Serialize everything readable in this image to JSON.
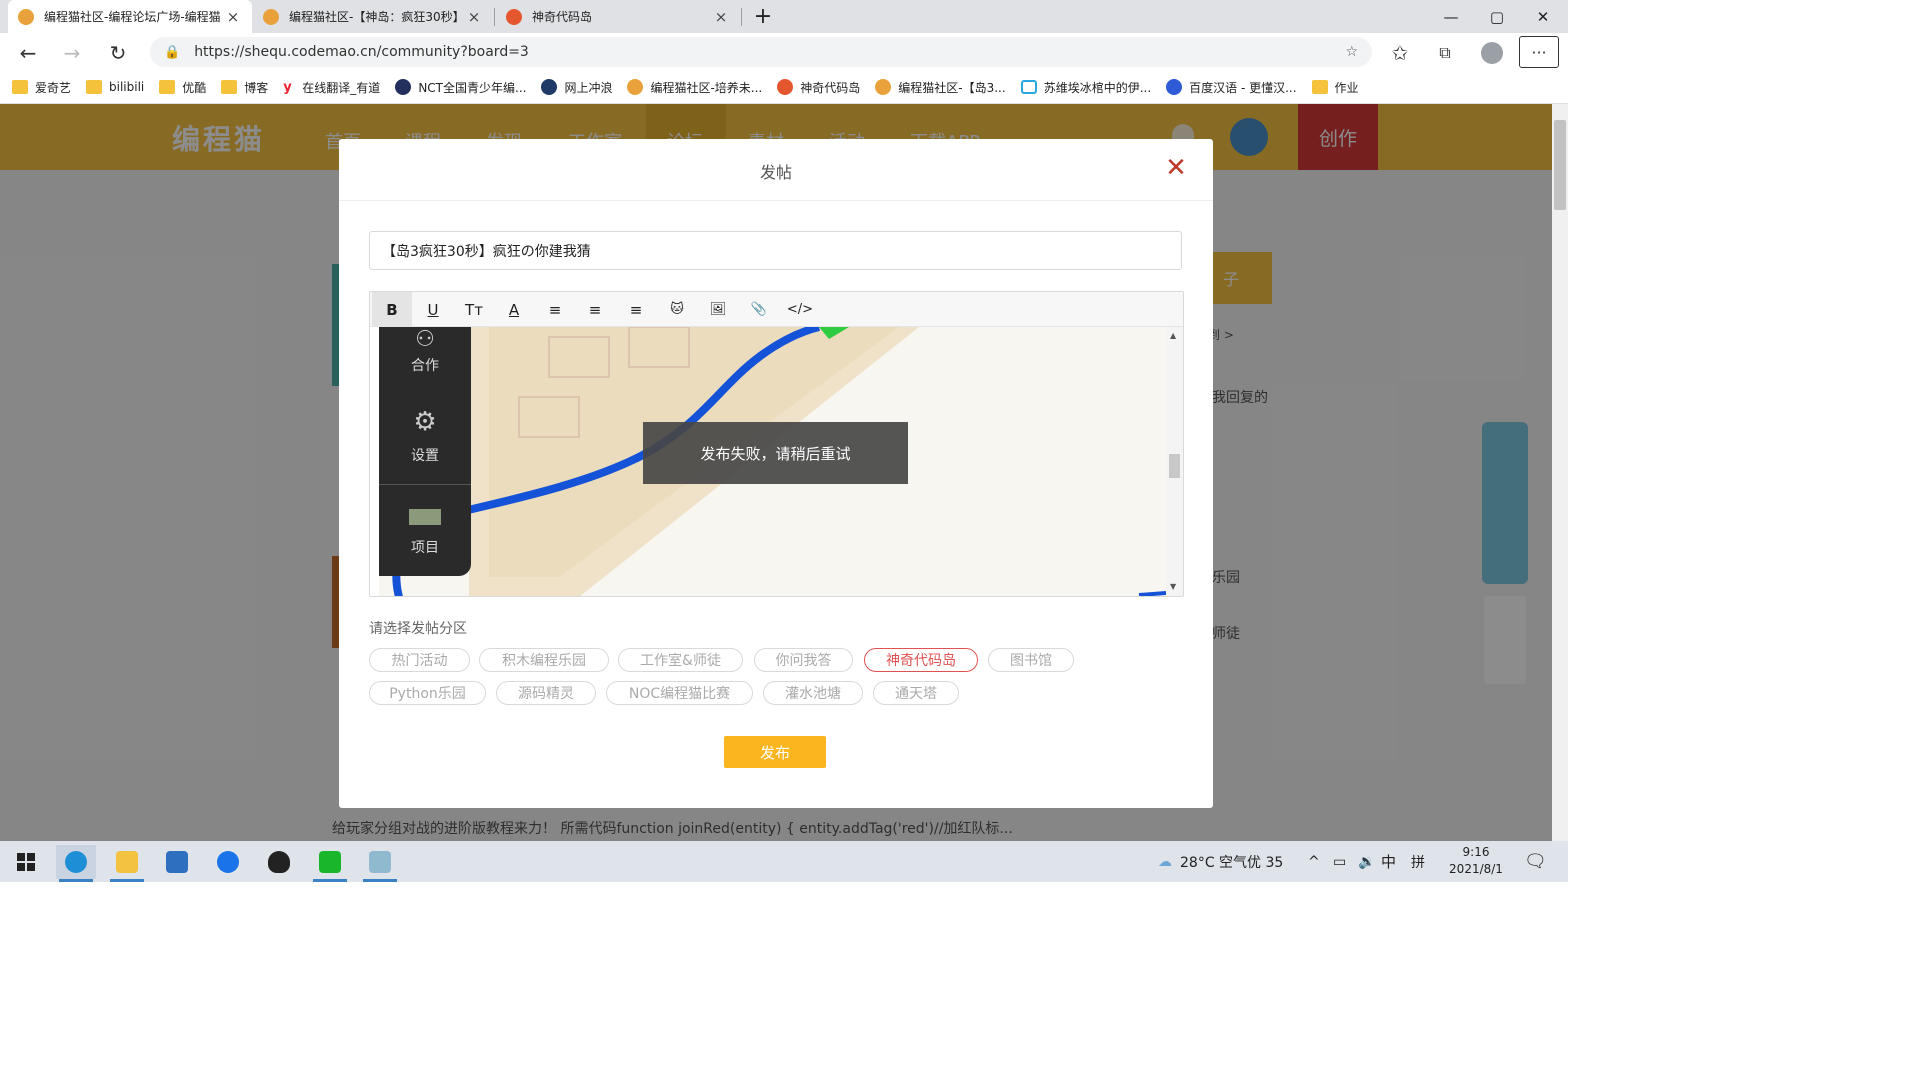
{
  "browser": {
    "tabs": [
      {
        "title": "编程猫社区-编程论坛广场-编程猫",
        "favicon_color": "#e9a23b",
        "active": true
      },
      {
        "title": "编程猫社区-【神岛：疯狂30秒】",
        "favicon_color": "#e9a23b",
        "active": false
      },
      {
        "title": "神奇代码岛",
        "favicon_color": "#e4572e",
        "active": false
      }
    ],
    "new_tab_symbol": "+",
    "close_symbol": "×",
    "window_controls": {
      "minimize": "—",
      "maximize": "▢",
      "close": "✕"
    },
    "url": "https://shequ.codemao.cn/community?board=3",
    "bookmarks": [
      {
        "label": "爱奇艺",
        "icon": "folder-icon"
      },
      {
        "label": "bilibili",
        "icon": "folder-icon"
      },
      {
        "label": "优酷",
        "icon": "folder-icon"
      },
      {
        "label": "博客",
        "icon": "folder-icon"
      },
      {
        "label": "在线翻译_有道",
        "icon": "youdao-icon"
      },
      {
        "label": "NCT全国青少年编...",
        "icon": "nct-icon"
      },
      {
        "label": "网上冲浪",
        "icon": "globe-icon"
      },
      {
        "label": "编程猫社区-培养未...",
        "icon": "codemao-icon"
      },
      {
        "label": "神奇代码岛",
        "icon": "codeisland-icon"
      },
      {
        "label": "编程猫社区-【岛3...",
        "icon": "codemao-icon"
      },
      {
        "label": "苏维埃冰棺中的伊...",
        "icon": "bilibili-icon"
      },
      {
        "label": "百度汉语 - 更懂汉...",
        "icon": "baidu-icon"
      },
      {
        "label": "作业",
        "icon": "folder-icon"
      }
    ]
  },
  "site": {
    "logo": "编程猫",
    "nav": [
      "首页",
      "课程",
      "发现",
      "工作室",
      "论坛",
      "素材",
      "活动",
      "下载APP"
    ],
    "create_label": "创作",
    "accent": "#f6c343"
  },
  "modal": {
    "title": "发帖",
    "close_symbol": "✕",
    "post_title_value": "【岛3疯狂30秒】疯狂の你建我猜",
    "toolbar": [
      "B",
      "U",
      "Tт",
      "A",
      "≡",
      "≡",
      "≡",
      "🐱",
      "🖼",
      "📎",
      "</>"
    ],
    "editor_panel": {
      "item1": "合作",
      "item2": "设置",
      "item3": "项目"
    },
    "toast": "发布失败，请稍后重试",
    "section_label": "请选择发帖分区",
    "sections_row1": [
      "热门活动",
      "积木编程乐园",
      "工作室&师徒",
      "你问我答",
      "神奇代码岛",
      "图书馆"
    ],
    "sections_row2": [
      "Python乐园",
      "源码精灵",
      "NOC编程猫比赛",
      "灌水池塘",
      "通天塔"
    ],
    "selected_section": "神奇代码岛",
    "publish_label": "发布",
    "publish_color": "#fbb51f",
    "selected_color": "#e05252"
  },
  "background_page": {
    "right_snippets": [
      "子",
      "到 >",
      "我回复的",
      "乐园",
      "师徒"
    ],
    "post_excerpt": "给玩家分组对战的进阶版教程来力！ 所需代码function joinRed(entity) { entity.addTag('red')//加红队标..."
  },
  "taskbar": {
    "weather": "28°C 空气优 35",
    "ime": "中",
    "ime2": "拼",
    "time": "9:16",
    "date": "2021/8/1"
  }
}
